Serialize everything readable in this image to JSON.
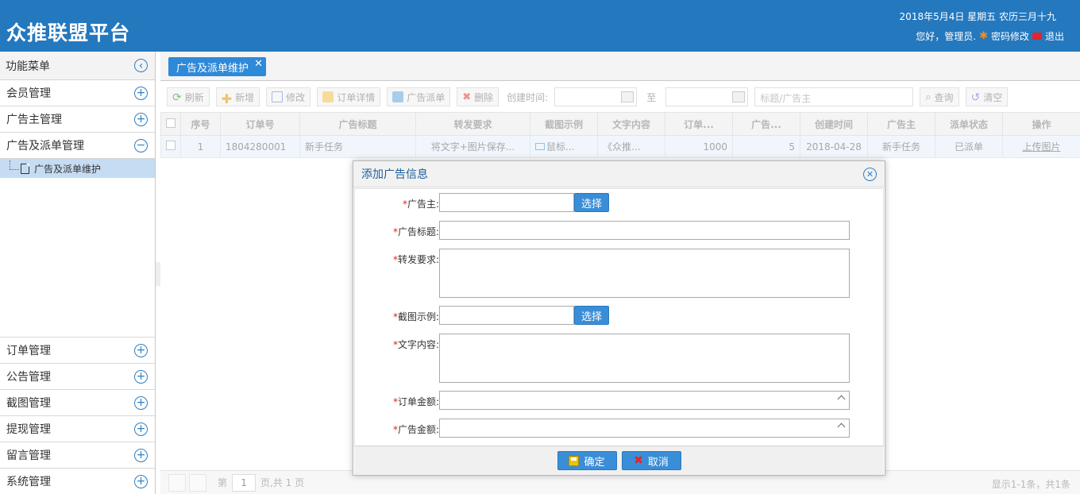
{
  "header": {
    "logo": "众推联盟平台",
    "date": "2018年5月4日 星期五 农历三月十九",
    "greeting": "您好，管理员.",
    "change_password": "密码修改",
    "logout": "退出"
  },
  "sidebar": {
    "title": "功能菜单",
    "items": [
      {
        "label": "会员管理"
      },
      {
        "label": "广告主管理"
      },
      {
        "label": "广告及派单管理"
      }
    ],
    "sub_item": "广告及派单维护",
    "bottom_items": [
      {
        "label": "订单管理"
      },
      {
        "label": "公告管理"
      },
      {
        "label": "截图管理"
      },
      {
        "label": "提现管理"
      },
      {
        "label": "留言管理"
      },
      {
        "label": "系统管理"
      }
    ]
  },
  "tabs": {
    "active": "广告及派单维护"
  },
  "toolbar": {
    "refresh": "刷新",
    "add": "新增",
    "edit": "修改",
    "order_detail": "订单详情",
    "dispatch": "广告派单",
    "delete": "删除",
    "created_time_label": "创建时间:",
    "to_label": "至",
    "search_placeholder": "标题/广告主",
    "query": "查询",
    "clear": "清空"
  },
  "grid": {
    "columns": [
      "序号",
      "订单号",
      "广告标题",
      "转发要求",
      "截图示例",
      "文字内容",
      "订单...",
      "广告...",
      "创建时间",
      "广告主",
      "派单状态",
      "操作"
    ],
    "rows": [
      {
        "index": "1",
        "order_no": "1804280001",
        "title": "新手任务",
        "requirement": "将文字+图片保存...",
        "screenshot": "鼠标...",
        "text": "《众推...",
        "order_amount": "1000",
        "ad_amount": "5",
        "created": "2018-04-28",
        "advertiser": "新手任务",
        "status": "已派单",
        "action": "上传图片"
      }
    ]
  },
  "pager": {
    "page_label": "第",
    "page_value": "1",
    "page_total": "页,共 1 页",
    "info": "显示1-1条，共1条"
  },
  "dialog": {
    "title": "添加广告信息",
    "fields": {
      "advertiser": "广告主:",
      "title": "广告标题:",
      "requirement": "转发要求:",
      "screenshot": "截图示例:",
      "text": "文字内容:",
      "order_amount": "订单金额:",
      "ad_amount": "广告金额:"
    },
    "required_mark": "*",
    "select": "选择",
    "confirm": "确定",
    "cancel": "取消"
  }
}
